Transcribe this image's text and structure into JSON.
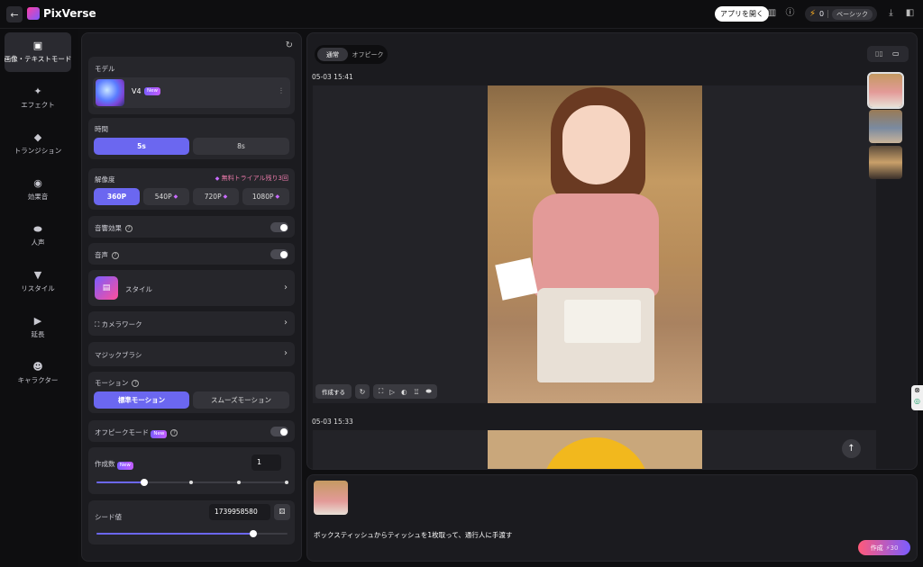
{
  "header": {
    "brand": "PixVerse",
    "back_icon": "←",
    "open_app": "アプリを開く",
    "credits": "0",
    "plan": "ベーシック"
  },
  "sidebar": {
    "items": [
      {
        "label": "画像・テキストモード",
        "icon": "image-icon",
        "glyph": "▣"
      },
      {
        "label": "エフェクト",
        "icon": "sparkle-icon",
        "glyph": "✦"
      },
      {
        "label": "トランジション",
        "icon": "transition-icon",
        "glyph": "◆"
      },
      {
        "label": "効果音",
        "icon": "sound-effect-icon",
        "glyph": "◉"
      },
      {
        "label": "人声",
        "icon": "lips-icon",
        "glyph": "⬬"
      },
      {
        "label": "リスタイル",
        "icon": "brush-icon",
        "glyph": "▼"
      },
      {
        "label": "延長",
        "icon": "extend-icon",
        "glyph": "▶"
      },
      {
        "label": "キャラクター",
        "icon": "character-icon",
        "glyph": "☻"
      }
    ]
  },
  "panel": {
    "model": {
      "label": "モデル",
      "name": "V4",
      "badge": "New"
    },
    "duration": {
      "label": "時間",
      "options": [
        "5s",
        "8s"
      ],
      "selected": "5s"
    },
    "resolution": {
      "label": "解像度",
      "trial": "無料トライアル残り3回",
      "options": [
        "360P",
        "540P",
        "720P",
        "1080P"
      ],
      "selected": "360P"
    },
    "sound_effect": {
      "label": "音響効果",
      "enabled": false
    },
    "voice": {
      "label": "音声",
      "enabled": false
    },
    "style": {
      "label": "スタイル"
    },
    "camera": {
      "label": "カメラワーク"
    },
    "magic_brush": {
      "label": "マジックブラシ"
    },
    "motion": {
      "label": "モーション",
      "options": [
        "標準モーション",
        "スムーズモーション"
      ],
      "selected": "標準モーション"
    },
    "off_peak": {
      "label": "オフピークモード",
      "badge": "New",
      "enabled": false
    },
    "count": {
      "label": "作成数",
      "badge": "New",
      "value": "1",
      "level": 0.25
    },
    "seed": {
      "label": "シード値",
      "value": "1739958580",
      "level": 0.82
    }
  },
  "main": {
    "tabs": [
      "通常",
      "オフピーク"
    ],
    "active_tab": "通常",
    "results": [
      {
        "timestamp": "05-03 15:41",
        "make_label": "作成する"
      },
      {
        "timestamp": "05-03 15:33"
      }
    ]
  },
  "prompt": {
    "text": "ボックスティッシュからティッシュを1枚取って、通行人に手渡す",
    "generate_label": "作成",
    "cost": "30"
  },
  "colors": {
    "accent": "#6b67f0",
    "trial": "#e879a8",
    "gem": "#c86bff"
  }
}
